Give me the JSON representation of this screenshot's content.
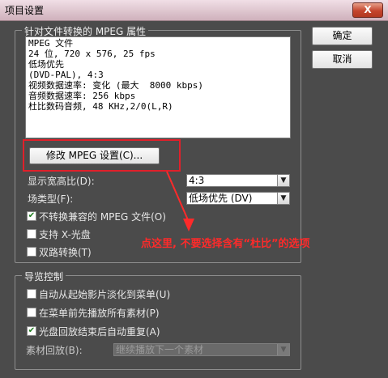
{
  "window": {
    "title": "项目设置",
    "close_symbol": "X"
  },
  "colors": {
    "annotation": "#ff2a2a",
    "accent_box": "#e0202a",
    "checkmark": "#1e7d1e"
  },
  "properties_group": {
    "legend": "针对文件转换的 MPEG 属性",
    "info_lines": [
      "MPEG 文件",
      "24 位, 720 x 576, 25 fps",
      "低场优先",
      "(DVD-PAL), 4:3",
      "视频数据速率: 变化 (最大  8000 kbps)",
      "音频数据速率: 256 kbps",
      "杜比数码音频, 48 KHz,2/0(L,R)"
    ],
    "modify_button": "修改 MPEG 设置(C)...",
    "aspect_label": "显示宽高比(D):",
    "aspect_value": "4:3",
    "field_label": "场类型(F):",
    "field_value": "低场优先 (DV)",
    "no_convert_label": "不转换兼容的 MPEG 文件(O)",
    "no_convert_checked": true,
    "xcd_label": "支持 X-光盘",
    "xcd_checked": false,
    "dual_label": "双路转换(T)",
    "dual_checked": false
  },
  "preview_group": {
    "legend": "导览控制",
    "auto_fade_label": "自动从起始影片淡化到菜单(U)",
    "auto_fade_checked": false,
    "play_all_label": "在菜单前先播放所有素材(P)",
    "play_all_checked": false,
    "auto_repeat_label": "光盘回放结束后自动重复(A)",
    "auto_repeat_checked": true,
    "playback_label": "素材回放(B):",
    "playback_value": "继续播放下一个素材"
  },
  "buttons": {
    "ok": "确定",
    "cancel": "取消"
  },
  "annotation": {
    "text": "点这里, 不要选择含有“杜比”的选项"
  }
}
